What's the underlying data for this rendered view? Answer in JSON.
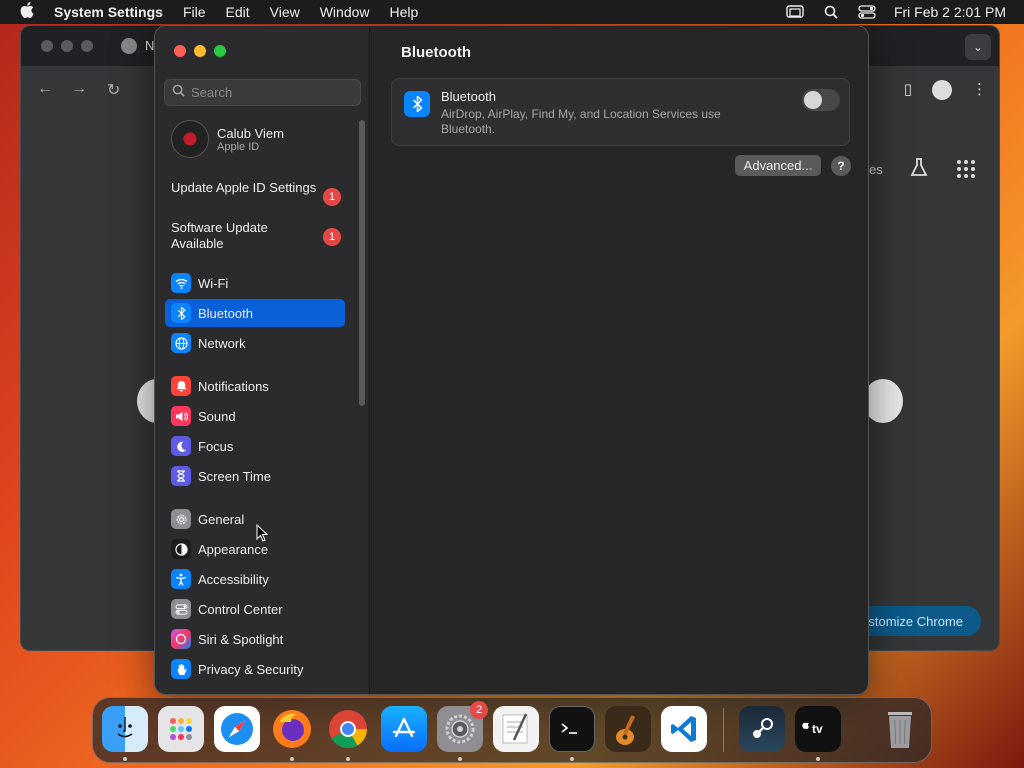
{
  "menubar": {
    "app_name": "System Settings",
    "items": [
      "File",
      "Edit",
      "View",
      "Window",
      "Help"
    ],
    "datetime": "Fri Feb 2  2:01 PM"
  },
  "chrome": {
    "tab_title": "N",
    "partial_text": "es",
    "customize_label": "stomize Chrome"
  },
  "sidebar": {
    "search_placeholder": "Search",
    "profile": {
      "name": "Calub Viem",
      "sub": "Apple ID"
    },
    "alerts": [
      {
        "label": "Update Apple ID Settings",
        "count": "1"
      },
      {
        "label": "Software Update Available",
        "count": "1"
      }
    ],
    "items": [
      {
        "label": "Wi-Fi",
        "icon": "wifi-icon",
        "color": "#0a84ff"
      },
      {
        "label": "Bluetooth",
        "icon": "bluetooth-icon",
        "color": "#0a84ff"
      },
      {
        "label": "Network",
        "icon": "globe-icon",
        "color": "#0a84ff"
      },
      {
        "label": "Notifications",
        "icon": "bell-icon",
        "color": "#ff453a"
      },
      {
        "label": "Sound",
        "icon": "speaker-icon",
        "color": "#ff375f"
      },
      {
        "label": "Focus",
        "icon": "moon-icon",
        "color": "#5e5ce6"
      },
      {
        "label": "Screen Time",
        "icon": "hourglass-icon",
        "color": "#5e5ce6"
      },
      {
        "label": "General",
        "icon": "gear-icon",
        "color": "#8e8e93"
      },
      {
        "label": "Appearance",
        "icon": "appearance-icon",
        "color": "#1c1c1e"
      },
      {
        "label": "Accessibility",
        "icon": "accessibility-icon",
        "color": "#0a84ff"
      },
      {
        "label": "Control Center",
        "icon": "control-center-icon",
        "color": "#8e8e93"
      },
      {
        "label": "Siri & Spotlight",
        "icon": "siri-icon",
        "color": "#bf5af2"
      },
      {
        "label": "Privacy & Security",
        "icon": "hand-icon",
        "color": "#0a84ff"
      }
    ]
  },
  "main": {
    "title": "Bluetooth",
    "card_title": "Bluetooth",
    "card_desc": "AirDrop, AirPlay, Find My, and Location Services use Bluetooth.",
    "toggle_on": false,
    "advanced_label": "Advanced...",
    "help_label": "?"
  },
  "dock": {
    "settings_badge": "2"
  }
}
